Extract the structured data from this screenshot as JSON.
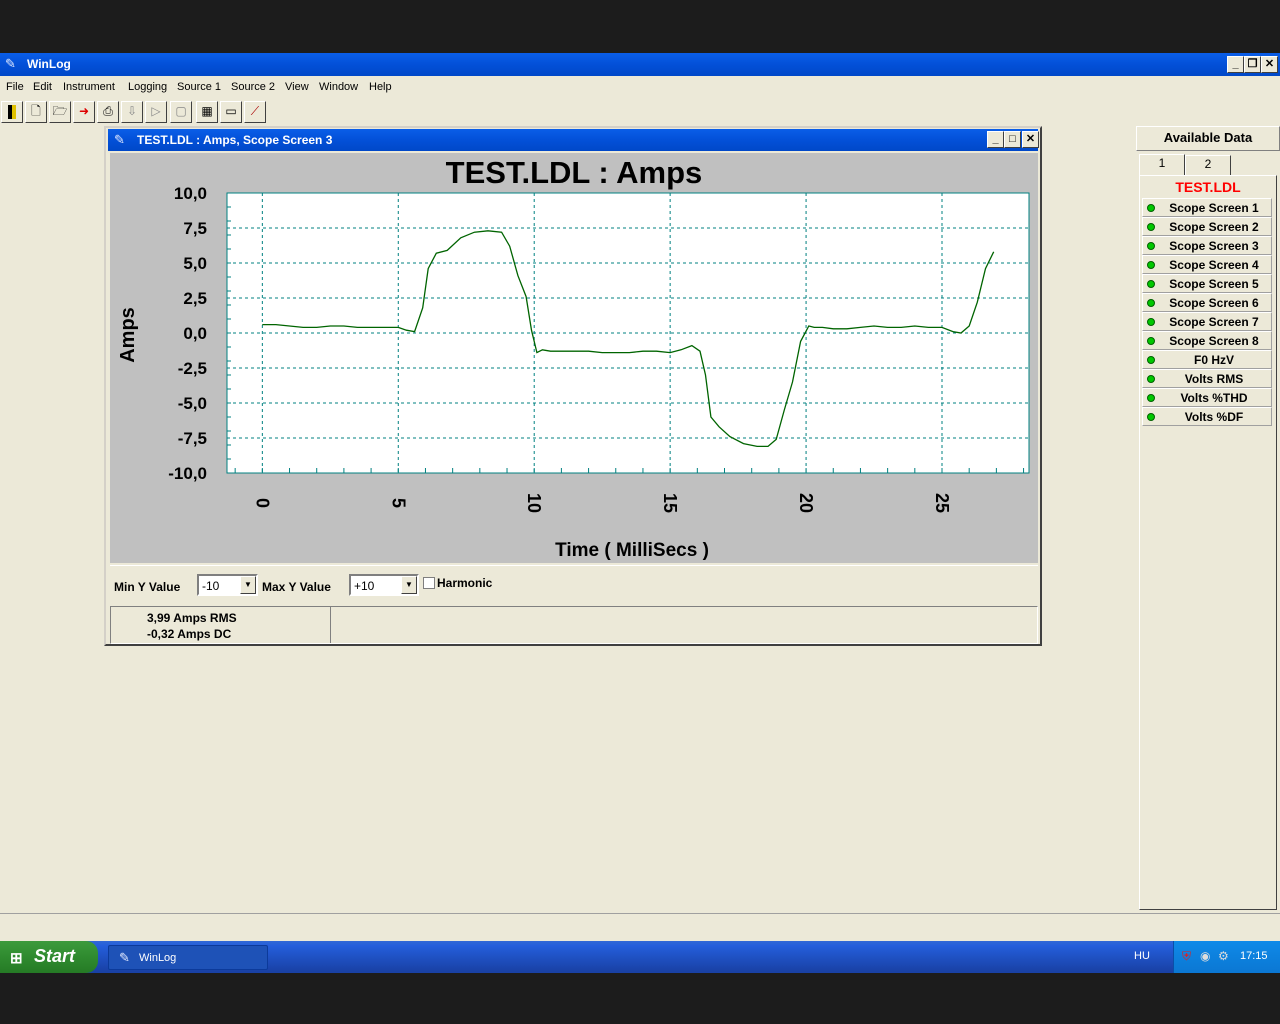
{
  "app": {
    "title": "WinLog"
  },
  "menu": [
    "File",
    "Edit",
    "Instrument",
    "Logging",
    "Source 1",
    "Source 2",
    "View",
    "Window",
    "Help"
  ],
  "child_window": {
    "title": "TEST.LDL : Amps, Scope Screen 3",
    "controls": {
      "min_label": "Min Y Value",
      "min_value": "-10",
      "max_label": "Max Y Value",
      "max_value": "+10",
      "harmonic_label": "Harmonic"
    },
    "status": {
      "rms": "3,99 Amps RMS",
      "dc": "-0,32 Amps DC"
    }
  },
  "chart_data": {
    "type": "line",
    "title": "TEST.LDL : Amps",
    "xlabel": "Time ( MilliSecs )",
    "ylabel": "Amps",
    "xlim": [
      -1.3,
      28.2
    ],
    "ylim": [
      -10,
      10
    ],
    "xticks": [
      "0",
      "5",
      "10",
      "15",
      "20",
      "25"
    ],
    "yticks": [
      "10,0",
      "7,5",
      "5,0",
      "2,5",
      "0,0",
      "-2,5",
      "-5,0",
      "-7,5",
      "-10,0"
    ],
    "grid": true,
    "line_color": "#006400",
    "x": [
      0,
      0.5,
      1,
      1.5,
      2,
      2.5,
      3,
      3.5,
      4,
      4.5,
      5,
      5.3,
      5.6,
      5.9,
      6.1,
      6.4,
      6.8,
      7.3,
      7.8,
      8.3,
      8.8,
      9.1,
      9.4,
      9.7,
      9.9,
      10.1,
      10.3,
      10.6,
      11,
      11.5,
      12,
      12.5,
      13,
      13.5,
      14,
      14.5,
      15,
      15.4,
      15.8,
      16.1,
      16.3,
      16.5,
      16.8,
      17.2,
      17.7,
      18.2,
      18.6,
      18.9,
      19.2,
      19.5,
      19.8,
      20.1,
      20.3,
      20.6,
      21,
      21.5,
      22,
      22.5,
      23,
      23.5,
      24,
      24.5,
      25,
      25.4,
      25.7,
      26,
      26.3,
      26.6,
      26.9
    ],
    "values": [
      0.6,
      0.6,
      0.5,
      0.4,
      0.4,
      0.5,
      0.5,
      0.4,
      0.4,
      0.4,
      0.4,
      0.2,
      0.1,
      1.8,
      4.6,
      5.7,
      5.9,
      6.8,
      7.2,
      7.3,
      7.2,
      6.2,
      4.1,
      2.6,
      0.2,
      -1.4,
      -1.2,
      -1.3,
      -1.3,
      -1.3,
      -1.3,
      -1.4,
      -1.4,
      -1.4,
      -1.3,
      -1.3,
      -1.4,
      -1.2,
      -0.9,
      -1.3,
      -3.0,
      -6.0,
      -6.7,
      -7.4,
      -7.9,
      -8.1,
      -8.1,
      -7.6,
      -5.5,
      -3.5,
      -0.6,
      0.5,
      0.4,
      0.4,
      0.3,
      0.3,
      0.4,
      0.5,
      0.4,
      0.4,
      0.5,
      0.4,
      0.4,
      0.1,
      0.0,
      0.5,
      2.2,
      4.6,
      5.8
    ]
  },
  "panel": {
    "title": "Available Data",
    "tabs": [
      "1",
      "2"
    ],
    "file": "TEST.LDL",
    "items": [
      "Scope Screen 1",
      "Scope Screen 2",
      "Scope Screen 3",
      "Scope Screen 4",
      "Scope Screen 5",
      "Scope Screen 6",
      "Scope Screen 7",
      "Scope Screen 8",
      "F0 HzV",
      "Volts RMS",
      "Volts %THD",
      "Volts %DF"
    ]
  },
  "taskbar": {
    "start": "Start",
    "task": "WinLog",
    "lang": "HU",
    "clock": "17:15"
  },
  "icons": [
    "app-icon",
    "new-icon",
    "open-icon",
    "save-icon",
    "export-icon",
    "print-icon",
    "download-icon",
    "play-icon",
    "stop-icon",
    "table-icon",
    "monitor-icon",
    "chart-icon"
  ],
  "colors": {
    "titlebar": "#0350d8",
    "plot_bg": "#ffffff",
    "frame_bg": "#c0c0c0",
    "grid": "#008080",
    "file_label": "#ff0000",
    "status_dot": "#00c800"
  }
}
